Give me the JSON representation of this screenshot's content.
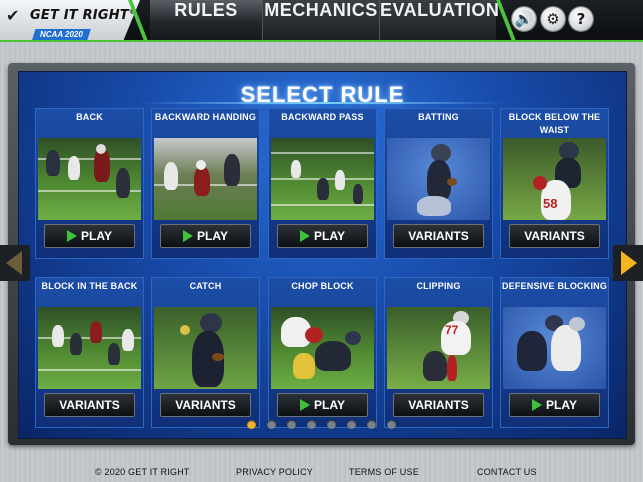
{
  "header": {
    "logo_text": "GET IT RIGHT",
    "logo_reg": "®",
    "logo_sub": "NCAA 2020",
    "tabs": [
      {
        "label": "RULES",
        "active": true
      },
      {
        "label": "MECHANICS",
        "active": false
      },
      {
        "label": "EVALUATION",
        "active": false
      }
    ],
    "icons": [
      "volume-icon",
      "settings-icon",
      "help-icon"
    ],
    "icon_glyphs": {
      "volume": "🔊",
      "settings": "⚙",
      "help": "?"
    },
    "accent_color": "#4cc43a"
  },
  "main": {
    "title": "SELECT RULE",
    "cards": [
      {
        "title": "BACK",
        "button": "PLAY",
        "action": "play"
      },
      {
        "title": "BACKWARD HANDING",
        "button": "PLAY",
        "action": "play"
      },
      {
        "title": "BACKWARD PASS",
        "button": "PLAY",
        "action": "play"
      },
      {
        "title": "BATTING",
        "button": "VARIANTS",
        "action": "variants"
      },
      {
        "title": "BLOCK BELOW THE WAIST",
        "button": "VARIANTS",
        "action": "variants"
      },
      {
        "title": "BLOCK IN THE BACK",
        "button": "VARIANTS",
        "action": "variants"
      },
      {
        "title": "CATCH",
        "button": "VARIANTS",
        "action": "variants"
      },
      {
        "title": "CHOP BLOCK",
        "button": "PLAY",
        "action": "play"
      },
      {
        "title": "CLIPPING",
        "button": "VARIANTS",
        "action": "variants"
      },
      {
        "title": "DEFENSIVE BLOCKING",
        "button": "PLAY",
        "action": "play"
      }
    ],
    "jersey_numbers": {
      "card4": "58",
      "card8": "77"
    }
  },
  "pagination": {
    "pages": 8,
    "current": 1
  },
  "footer": {
    "copyright": "© 2020 GET IT RIGHT",
    "privacy": "PRIVACY POLICY",
    "terms": "TERMS OF USE",
    "contact": "CONTACT US"
  }
}
